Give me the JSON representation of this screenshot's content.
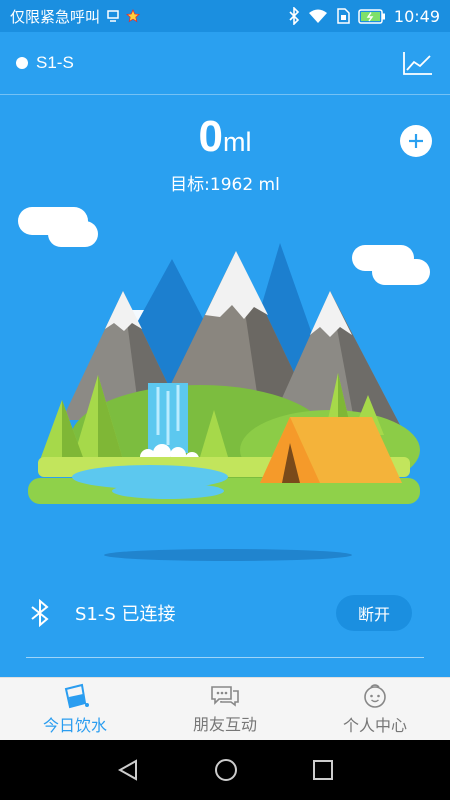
{
  "status_bar": {
    "carrier_text": "仅限紧急呼叫",
    "time": "10:49",
    "icons": [
      "usb-icon",
      "star-notification-icon",
      "bluetooth-icon",
      "wifi-icon",
      "sim-icon",
      "battery-icon"
    ]
  },
  "header": {
    "device_name": "S1-S",
    "chart_icon": "line-chart-icon"
  },
  "intake": {
    "value": "0",
    "unit": "ml",
    "goal_label": "目标:1962 ml"
  },
  "add_button_icon": "plus-icon",
  "connection": {
    "icon": "bluetooth-icon",
    "status": "S1-S 已连接",
    "disconnect_label": "断开"
  },
  "tabs": [
    {
      "label": "今日饮水",
      "icon": "water-cup-icon",
      "active": true
    },
    {
      "label": "朋友互动",
      "icon": "chat-icon",
      "active": false
    },
    {
      "label": "个人中心",
      "icon": "face-icon",
      "active": false
    }
  ],
  "nav_bar": {
    "icons": [
      "back-icon",
      "home-icon",
      "recents-icon"
    ]
  },
  "colors": {
    "background": "#2aa0f0",
    "status_bar": "#1b8fe0",
    "accent": "#2a9df0",
    "tab_bar": "#f5f5f5"
  }
}
